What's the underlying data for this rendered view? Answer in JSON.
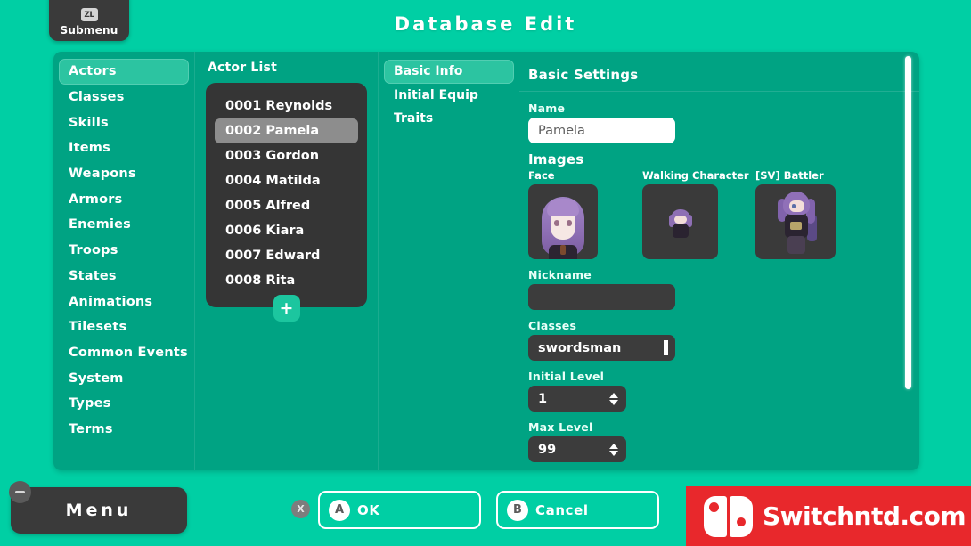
{
  "window_title": "Database Edit",
  "topbar": {
    "submenu_key": "ZL",
    "submenu_label": "Submenu"
  },
  "sidebar": {
    "items": [
      {
        "label": "Actors",
        "selected": true
      },
      {
        "label": "Classes",
        "selected": false
      },
      {
        "label": "Skills",
        "selected": false
      },
      {
        "label": "Items",
        "selected": false
      },
      {
        "label": "Weapons",
        "selected": false
      },
      {
        "label": "Armors",
        "selected": false
      },
      {
        "label": "Enemies",
        "selected": false
      },
      {
        "label": "Troops",
        "selected": false
      },
      {
        "label": "States",
        "selected": false
      },
      {
        "label": "Animations",
        "selected": false
      },
      {
        "label": "Tilesets",
        "selected": false
      },
      {
        "label": "Common Events",
        "selected": false
      },
      {
        "label": "System",
        "selected": false
      },
      {
        "label": "Types",
        "selected": false
      },
      {
        "label": "Terms",
        "selected": false
      }
    ]
  },
  "actor_list": {
    "header": "Actor List",
    "add_label": "+",
    "items": [
      {
        "label": "0001 Reynolds",
        "selected": false
      },
      {
        "label": "0002 Pamela",
        "selected": true
      },
      {
        "label": "0003 Gordon",
        "selected": false
      },
      {
        "label": "0004 Matilda",
        "selected": false
      },
      {
        "label": "0005 Alfred",
        "selected": false
      },
      {
        "label": "0006 Kiara",
        "selected": false
      },
      {
        "label": "0007 Edward",
        "selected": false
      },
      {
        "label": "0008 Rita",
        "selected": false
      }
    ]
  },
  "tabs": [
    {
      "label": "Basic Info",
      "selected": true
    },
    {
      "label": "Initial Equip",
      "selected": false
    },
    {
      "label": "Traits",
      "selected": false
    }
  ],
  "settings": {
    "title": "Basic Settings",
    "name": {
      "label": "Name",
      "value": "Pamela"
    },
    "images": {
      "title": "Images",
      "slots": [
        {
          "label": "Face"
        },
        {
          "label": "Walking Character"
        },
        {
          "label": "[SV] Battler"
        }
      ]
    },
    "nickname": {
      "label": "Nickname",
      "value": ""
    },
    "classes": {
      "label": "Classes",
      "value": "swordsman"
    },
    "initial_level": {
      "label": "Initial Level",
      "value": "1"
    },
    "max_level": {
      "label": "Max Level",
      "value": "99"
    }
  },
  "bottombar": {
    "menu_label": "Menu",
    "x_key": "X",
    "ok": {
      "key": "A",
      "label": "OK"
    },
    "cancel": {
      "key": "B",
      "label": "Cancel"
    }
  },
  "watermark": {
    "text": "Switchntd.com"
  },
  "colors": {
    "background": "#00cfa4",
    "panel": "#00a383",
    "selection": "#2cc4a1",
    "dark_panel": "#353535",
    "list_selection": "#8d8d8d",
    "watermark_red": "#e8282c"
  }
}
